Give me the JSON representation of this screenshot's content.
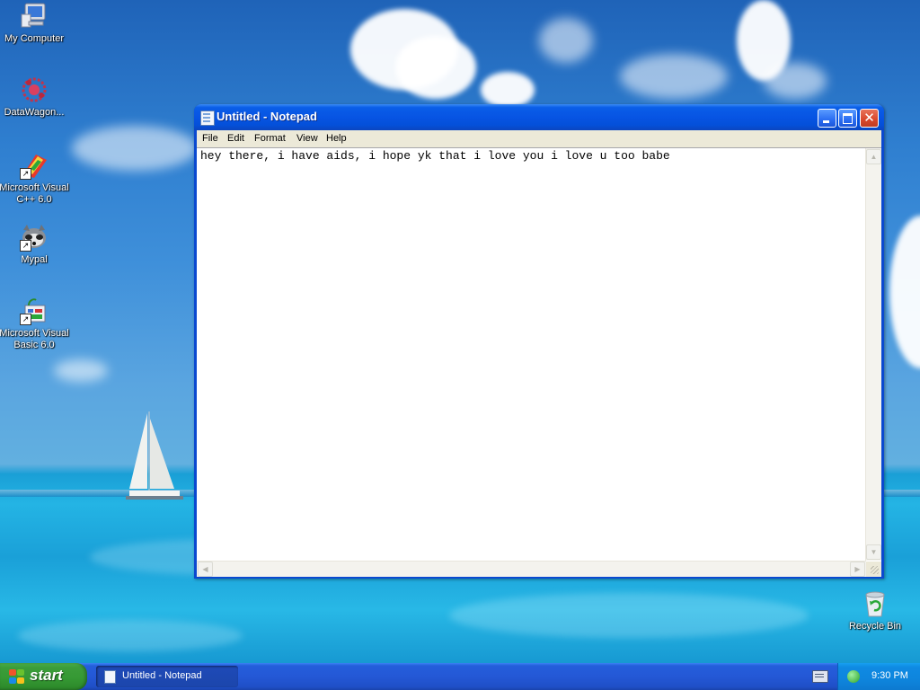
{
  "desktop": {
    "icons": [
      {
        "label": "My Computer",
        "icon": "my-computer-icon"
      },
      {
        "label": "DataWagon...",
        "icon": "datawagon-icon"
      },
      {
        "label": "Microsoft Visual C++ 6.0",
        "icon": "visual-cpp-icon"
      },
      {
        "label": "Mypal",
        "icon": "mypal-browser-icon"
      },
      {
        "label": "Microsoft Visual Basic 6.0",
        "icon": "visual-basic-icon"
      },
      {
        "label": "Recycle Bin",
        "icon": "recycle-bin-icon"
      }
    ]
  },
  "notepad": {
    "title": "Untitled - Notepad",
    "close_glyph": "✕",
    "menu": [
      "File",
      "Edit",
      "Format",
      "View",
      "Help"
    ],
    "content": "hey there, i have aids, i hope yk that i love you i love u too babe",
    "scroll_arrows": {
      "up": "▲",
      "down": "▼",
      "left": "◀",
      "right": "▶"
    }
  },
  "taskbar": {
    "start_label": "start",
    "tasks": [
      {
        "label": "Untitled - Notepad"
      }
    ],
    "clock": "9:30 PM"
  },
  "colors": {
    "titlebar": "#0454e0",
    "taskbar": "#245edb",
    "start_button": "#369934",
    "tray": "#0f8ae3",
    "menubar": "#ece9d8"
  }
}
